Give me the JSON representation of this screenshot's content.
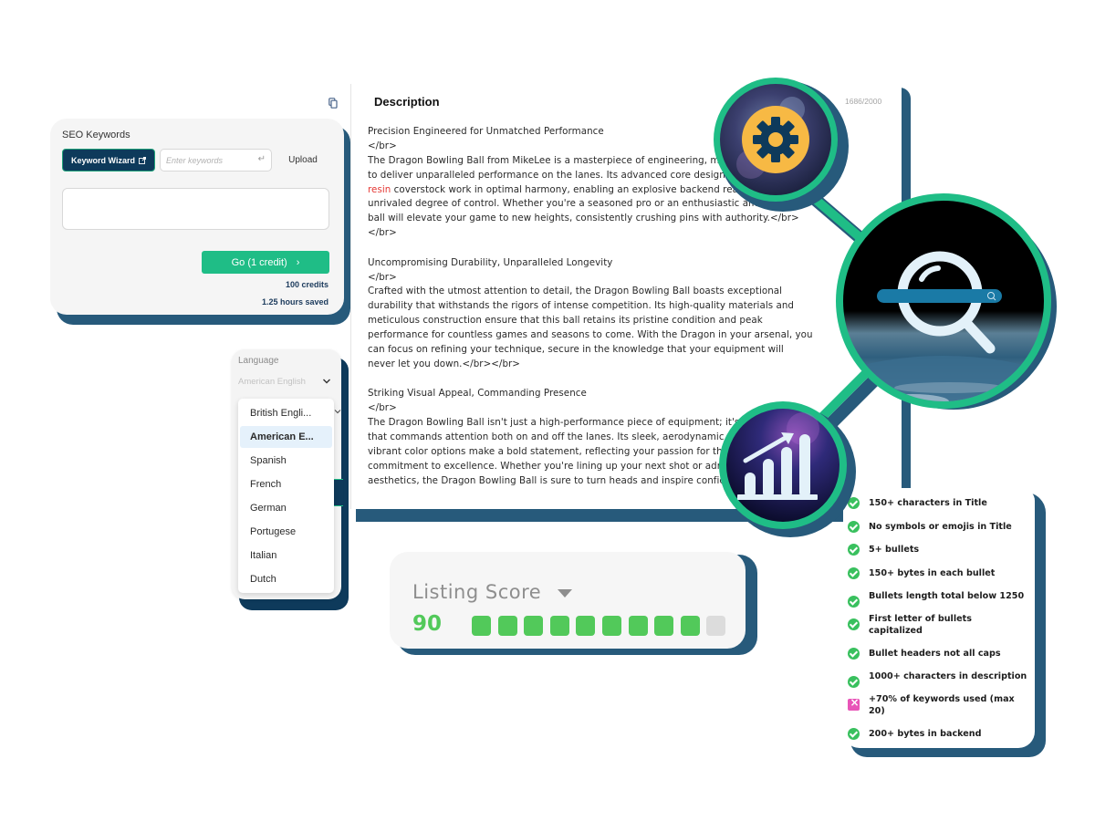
{
  "seo_keywords": {
    "label": "SEO Keywords",
    "keyword_wizard_label": "Keyword Wizard",
    "input_placeholder": "Enter keywords",
    "input_value": "",
    "upload_label": "Upload",
    "textarea_value": "",
    "go_label": "Go (1 credit)",
    "credits": "100 credits",
    "hours_saved": "1.25 hours saved"
  },
  "language": {
    "label": "Language",
    "selected": "American English",
    "options": [
      {
        "label": "British Engli...",
        "active": false
      },
      {
        "label": "American E...",
        "active": true
      },
      {
        "label": "Spanish",
        "active": false
      },
      {
        "label": "French",
        "active": false
      },
      {
        "label": "German",
        "active": false
      },
      {
        "label": "Portugese",
        "active": false
      },
      {
        "label": "Italian",
        "active": false
      },
      {
        "label": "Dutch",
        "active": false
      }
    ]
  },
  "description": {
    "title": "Description",
    "char_count": "1686/2000",
    "highlight_keyword": "resin",
    "lines": [
      "Precision Engineered for Unmatched Performance",
      "</br>",
      "The Dragon Bowling Ball from MikeLee is a masterpiece of engineering, meticulously crafted",
      "to deliver unparalleled performance on the lanes. Its advanced core design and high-grade",
      "resin| coverstock work in optimal harmony, enabling an explosive backend reaction and an",
      "unrivaled degree of control. Whether you're a seasoned pro or an enthusiastic amateur, this",
      "ball will elevate your game to new heights, consistently crushing pins with authority.</br>",
      "</br>",
      "",
      "Uncompromising Durability, Unparalleled Longevity",
      "</br>",
      "Crafted with the utmost attention to detail, the Dragon Bowling Ball boasts exceptional",
      "durability that withstands the rigors of intense competition. Its high-quality materials and",
      "meticulous construction ensure that this ball retains its pristine condition and peak",
      "performance for countless games and seasons to come. With the Dragon in your arsenal, you",
      "can focus on refining your technique, secure in the knowledge that your equipment will",
      "never let you down.</br></br>",
      "",
      "Striking Visual Appeal, Commanding Presence",
      "</br>",
      "The Dragon Bowling Ball isn't just a high-performance piece of equipment; it's a statement",
      "that commands attention both on and off the lanes. Its sleek, aerodynamic design and",
      "vibrant color options make a bold statement, reflecting your passion for the game and your",
      "commitment to excellence. Whether you're lining up your next shot or admiring its striking",
      "aesthetics, the Dragon Bowling Ball is sure to turn heads and inspire confidence."
    ]
  },
  "listing_score": {
    "label": "Listing Score",
    "value": "90",
    "filled_segments": 9,
    "total_segments": 10
  },
  "checklist": [
    {
      "label": "150+ characters in Title",
      "passed": true
    },
    {
      "label": "No symbols or emojis in Title",
      "passed": true
    },
    {
      "label": "5+ bullets",
      "passed": true
    },
    {
      "label": "150+ bytes in each bullet",
      "passed": true
    },
    {
      "label": "Bullets length total below 1250",
      "passed": true
    },
    {
      "label": "First letter of bullets capitalized",
      "passed": true
    },
    {
      "label": "Bullet headers not all caps",
      "passed": true
    },
    {
      "label": "1000+ characters in description",
      "passed": true
    },
    {
      "label": "+70% of keywords used (max 20)",
      "passed": false
    },
    {
      "label": "200+ bytes in backend",
      "passed": true
    }
  ],
  "colors": {
    "brand_navy": "#0e3a5b",
    "shadow_blue": "#275a7b",
    "accent_green": "#1fbd86",
    "score_green": "#52c95a",
    "gear_yellow": "#f7b944",
    "fail_pink": "#e855b8",
    "keyword_red": "#e53935"
  },
  "icons": {
    "copy": "copy-icon",
    "external_link": "external-link-icon",
    "enter_key": "enter-key-icon",
    "chevron": "chevron-down-icon",
    "gear": "gear-icon",
    "search": "search-icon",
    "growth_chart": "growth-chart-icon",
    "check": "check-circle-icon",
    "fail": "x-square-icon"
  }
}
